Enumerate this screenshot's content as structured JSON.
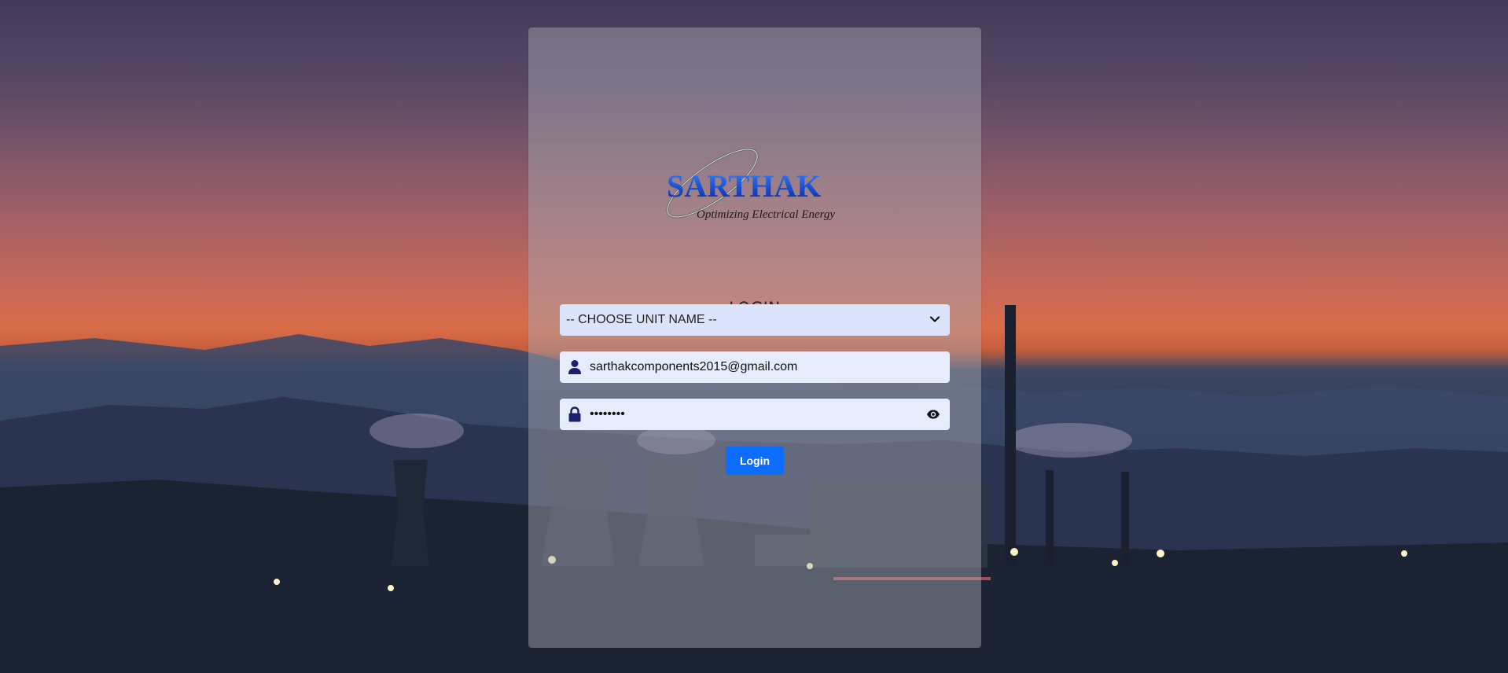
{
  "brand": {
    "wordmark": "SARTHAK",
    "tagline": "Optimizing Electrical Energy"
  },
  "login": {
    "title": "LOGIN",
    "unit_select": {
      "selected": "-- CHOOSE UNIT NAME --"
    },
    "email": {
      "value": "sarthakcomponents2015@gmail.com"
    },
    "password": {
      "masked_value": "••••••••"
    },
    "submit_label": "Login"
  },
  "icons": {
    "unit_select": "chevron-down-icon",
    "email": "user-icon",
    "password": "lock-icon",
    "reveal": "eye-icon",
    "logo": "sarthak-logo"
  },
  "colors": {
    "primary_button": "#0d6efd",
    "field_icon": "#1b1f6e",
    "logo_blue": "#1558e0"
  }
}
